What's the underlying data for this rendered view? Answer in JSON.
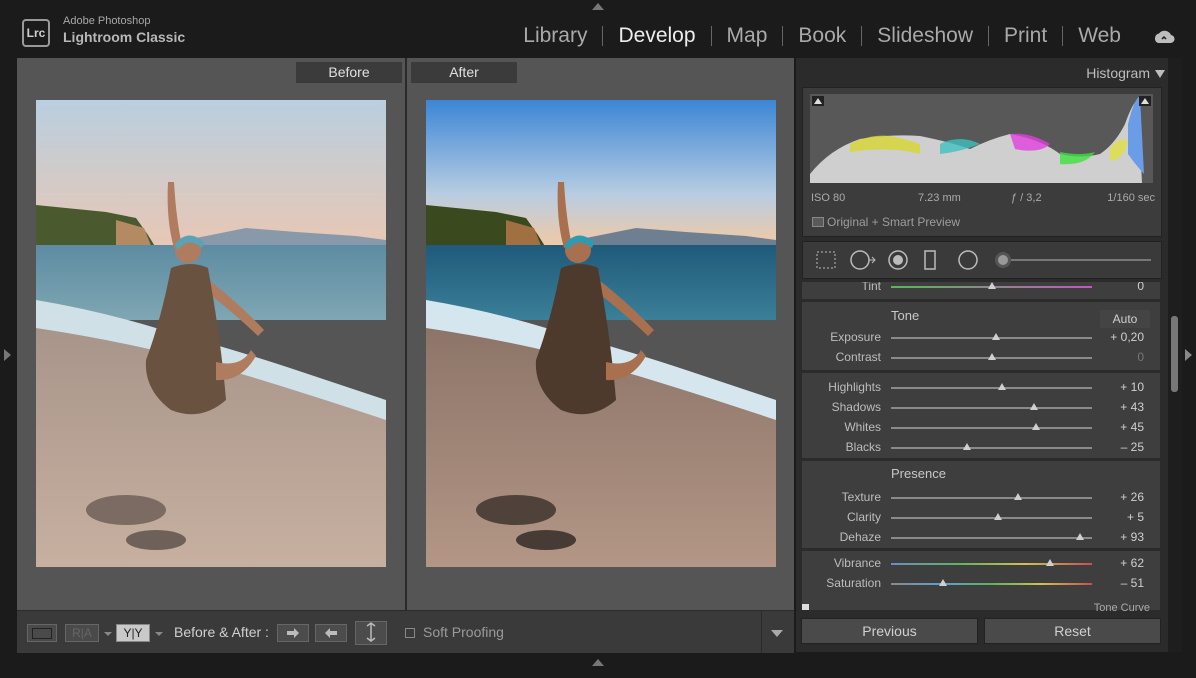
{
  "app": {
    "brand_small": "Adobe Photoshop",
    "brand_big": "Lightroom Classic",
    "logo": "Lrc"
  },
  "modules": [
    "Library",
    "Develop",
    "Map",
    "Book",
    "Slideshow",
    "Print",
    "Web"
  ],
  "active_module": "Develop",
  "view": {
    "before_label": "Before",
    "after_label": "After"
  },
  "toolbar": {
    "before_after_label": "Before & After :",
    "soft_proofing": "Soft Proofing",
    "ra_label": "R|A",
    "yy_label": "Y|Y"
  },
  "histogram": {
    "title": "Histogram",
    "iso": "ISO 80",
    "focal": "7.23 mm",
    "aperture": "ƒ / 3,2",
    "shutter": "1/160 sec",
    "preview": "Original + Smart Preview"
  },
  "basic": {
    "tint": {
      "label": "Tint",
      "value": "0",
      "pos": 0.5
    },
    "tone_title": "Tone",
    "auto_label": "Auto",
    "tone": [
      {
        "label": "Exposure",
        "value": "+ 0,20",
        "pos": 0.52
      },
      {
        "label": "Contrast",
        "value": "0",
        "pos": 0.5
      }
    ],
    "tone2": [
      {
        "label": "Highlights",
        "value": "+ 10",
        "pos": 0.55
      },
      {
        "label": "Shadows",
        "value": "+ 43",
        "pos": 0.71
      },
      {
        "label": "Whites",
        "value": "+ 45",
        "pos": 0.72
      },
      {
        "label": "Blacks",
        "value": "– 25",
        "pos": 0.38
      }
    ],
    "presence_title": "Presence",
    "presence": [
      {
        "label": "Texture",
        "value": "+ 26",
        "pos": 0.63
      },
      {
        "label": "Clarity",
        "value": "+ 5",
        "pos": 0.53
      },
      {
        "label": "Dehaze",
        "value": "+ 93",
        "pos": 0.94
      }
    ],
    "color": [
      {
        "label": "Vibrance",
        "value": "+ 62",
        "pos": 0.79
      },
      {
        "label": "Saturation",
        "value": "– 51",
        "pos": 0.26
      }
    ],
    "tone_curve": "Tone Curve"
  },
  "buttons": {
    "previous": "Previous",
    "reset": "Reset"
  },
  "colors": {
    "active_text": "#ededed",
    "panel": "#3e3e3e",
    "center": "#555555"
  }
}
